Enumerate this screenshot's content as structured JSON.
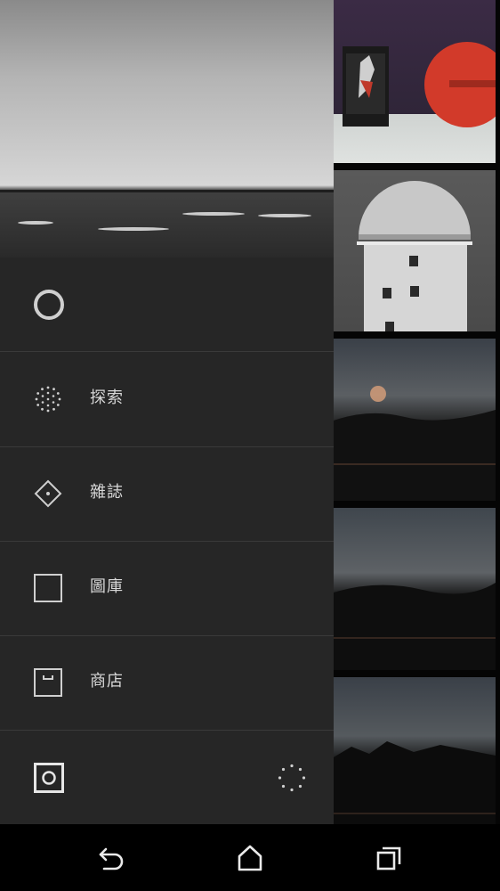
{
  "drawer": {
    "menu": [
      {
        "label": "探索",
        "icon": "explore-dots-icon"
      },
      {
        "label": "雜誌",
        "icon": "diamond-icon"
      },
      {
        "label": "圖庫",
        "icon": "square-icon"
      },
      {
        "label": "商店",
        "icon": "shop-box-icon"
      }
    ],
    "header_icon": "ring-icon",
    "footer": {
      "left_icon": "camera-square-icon",
      "right_icon": "loading-dots-icon"
    }
  },
  "photos": [
    "card-on-table",
    "radar-tower",
    "dusk-sky-1",
    "dusk-sky-2",
    "dusk-sky-3"
  ],
  "navbar": {
    "back_icon": "back-icon",
    "home_icon": "home-icon",
    "recents_icon": "recents-icon"
  }
}
